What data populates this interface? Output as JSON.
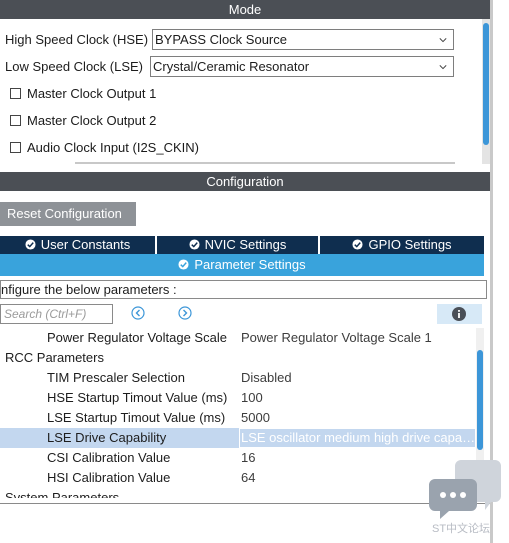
{
  "mode": {
    "header": "Mode",
    "hse_label": "High Speed Clock (HSE)",
    "hse_value": "BYPASS Clock Source",
    "lse_label": "Low Speed Clock (LSE)",
    "lse_value": "Crystal/Ceramic Resonator",
    "checkboxes": [
      {
        "label": "Master Clock Output 1",
        "checked": false
      },
      {
        "label": "Master Clock Output 2",
        "checked": false
      },
      {
        "label": "Audio Clock Input (I2S_CKIN)",
        "checked": false
      }
    ]
  },
  "configuration": {
    "header": "Configuration",
    "reset_label": "Reset Configuration",
    "tabs": [
      {
        "label": "User Constants"
      },
      {
        "label": "NVIC Settings"
      },
      {
        "label": "GPIO Settings"
      }
    ],
    "active_tab": "Parameter Settings",
    "configure_text": "nfigure the below parameters :",
    "search_placeholder": "Search (Ctrl+F)",
    "rows": [
      {
        "kind": "param",
        "name": "Power Regulator Voltage Scale",
        "value": "Power Regulator Voltage Scale 1"
      },
      {
        "kind": "group",
        "name": "RCC Parameters",
        "value": ""
      },
      {
        "kind": "param",
        "name": "TIM Prescaler Selection",
        "value": "Disabled"
      },
      {
        "kind": "param",
        "name": "HSE Startup Timout Value (ms)",
        "value": "100"
      },
      {
        "kind": "param",
        "name": "LSE Startup Timout Value (ms)",
        "value": "5000"
      },
      {
        "kind": "param",
        "name": "LSE Drive Capability",
        "value": "LSE oscillator medium high drive capa…",
        "selected": true
      },
      {
        "kind": "param",
        "name": "CSI Calibration Value",
        "value": "16"
      },
      {
        "kind": "param",
        "name": "HSI Calibration Value",
        "value": "64"
      },
      {
        "kind": "group",
        "name": "System Parameters",
        "value": ""
      }
    ]
  },
  "watermark": {
    "text": "ST中文论坛"
  },
  "colors": {
    "header_bg": "#4b4f55",
    "tab_bg": "#0f2e4f",
    "active_tab": "#39a3dc",
    "selection": "#c3d7ef",
    "scroll_thumb": "#3c96d8"
  }
}
